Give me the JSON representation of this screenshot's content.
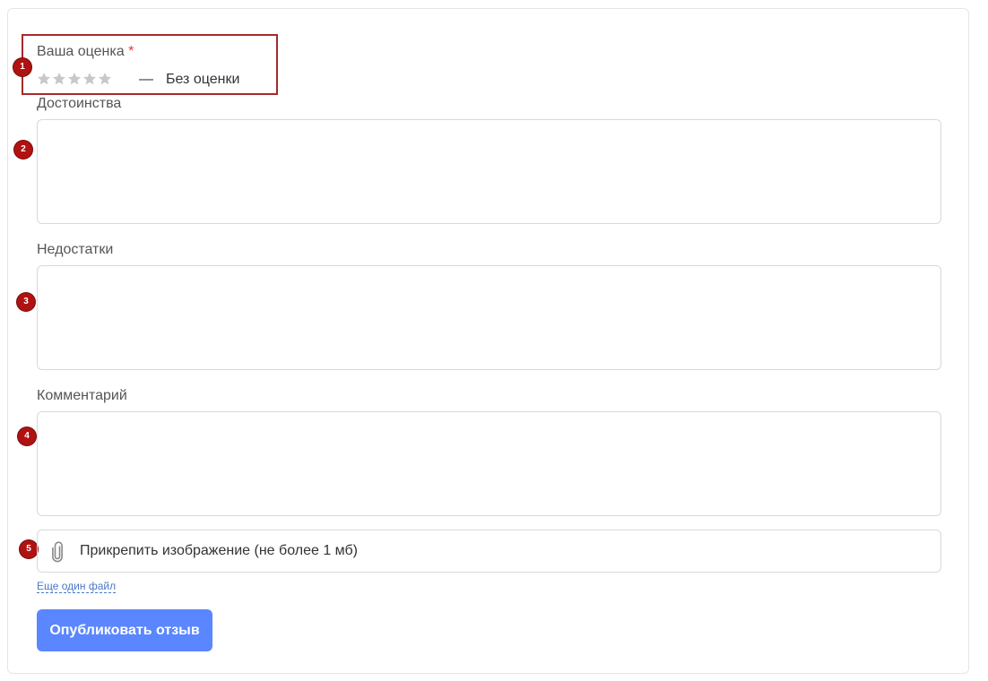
{
  "rating": {
    "label": "Ваша оценка",
    "required_mark": "*",
    "stars_total": 5,
    "stars_selected": 0,
    "dash": "—",
    "status": "Без оценки",
    "star_color": "#c8c8c8"
  },
  "fields": {
    "pros_label": "Достоинства",
    "pros_value": "",
    "cons_label": "Недостатки",
    "cons_value": "",
    "comment_label": "Комментарий",
    "comment_value": ""
  },
  "attachment": {
    "icon": "paperclip-icon",
    "label": "Прикрепить изображение (не более 1 мб)",
    "more_link": "Еще один файл"
  },
  "submit_label": "Опубликовать отзыв",
  "markers": [
    "1",
    "2",
    "3",
    "4",
    "5"
  ],
  "colors": {
    "accent": "#5a86ff",
    "marker": "#b01212",
    "required": "#e53935",
    "link": "#4a78c9"
  }
}
